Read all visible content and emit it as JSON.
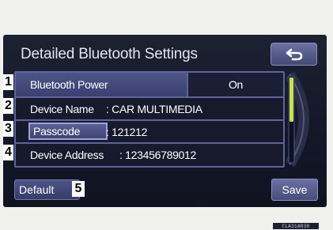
{
  "screen": {
    "title": "Detailed Bluetooth Settings"
  },
  "header": {
    "back_icon": "return-arrow-icon"
  },
  "rows": [
    {
      "num": "1",
      "label": "Bluetooth Power",
      "value": "On"
    },
    {
      "num": "2",
      "label": "Device Name",
      "value": ": CAR MULTIMEDIA"
    },
    {
      "num": "3",
      "label": "Passcode",
      "value": ": 121212"
    },
    {
      "num": "4",
      "label": "Device Address",
      "value": ": 123456789012"
    }
  ],
  "bottom": {
    "default_label": "Default",
    "default_num": "5",
    "save_label": "Save"
  },
  "figure_code": "CLA31AR38",
  "colors": {
    "screen_bg": "#14182a",
    "accent": "#5d6499",
    "scroll_indicator": "#c8e24b",
    "text": "#ffffff"
  }
}
